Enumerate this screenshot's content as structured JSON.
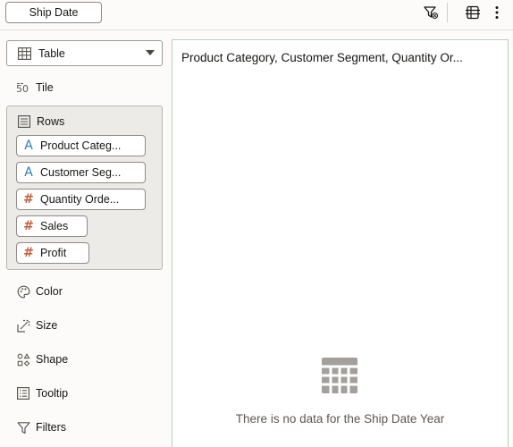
{
  "toolbar": {
    "filter_chip_label": "Ship Date",
    "icons": [
      "filter-clear-icon",
      "grammar-panel-icon",
      "more-vertical-icon"
    ]
  },
  "grammar": {
    "vis_type": "Table",
    "tile_label": "Tile",
    "rows_label": "Rows",
    "rows_items": [
      {
        "label": "Product Categ...",
        "kind": "attribute",
        "icon": "A"
      },
      {
        "label": "Customer Seg...",
        "kind": "attribute",
        "icon": "A"
      },
      {
        "label": "Quantity Orde...",
        "kind": "measure",
        "icon": "#"
      },
      {
        "label": "Sales",
        "kind": "measure",
        "icon": "#"
      },
      {
        "label": "Profit",
        "kind": "measure",
        "icon": "#"
      }
    ],
    "color_label": "Color",
    "size_label": "Size",
    "shape_label": "Shape",
    "tooltip_label": "Tooltip",
    "filters_label": "Filters"
  },
  "canvas": {
    "title": "Product Category, Customer Segment, Quantity Or...",
    "empty_message": "There is no data for the Ship Date Year"
  },
  "colors": {
    "attribute": "#2d7db3",
    "measure": "#c45e3a",
    "canvas_border": "#b3d1b8"
  }
}
